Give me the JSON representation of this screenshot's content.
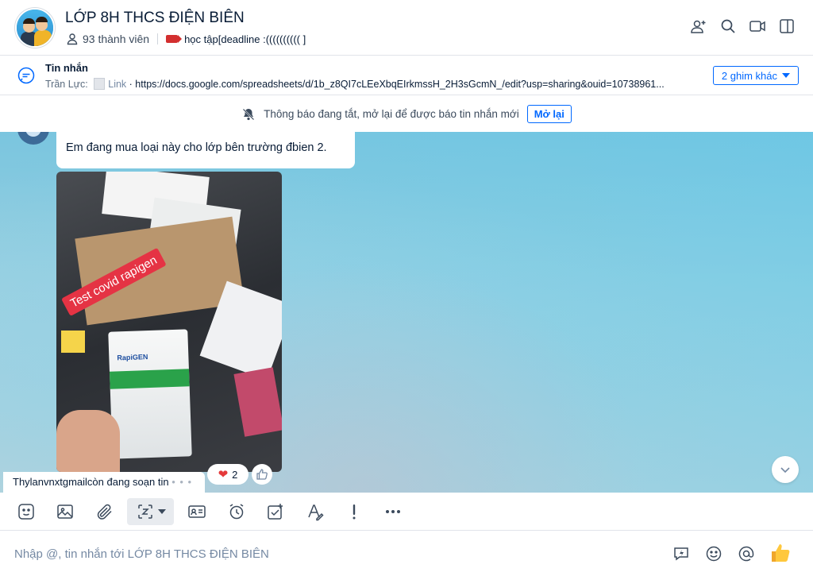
{
  "header": {
    "group_name": "LỚP 8H THCS ĐIỆN BIÊN",
    "members": "93 thành viên",
    "tag_label": "học tập[deadline :(((((((((( ]",
    "icons": [
      "add-member-icon",
      "search-icon",
      "video-call-icon",
      "sidebar-toggle-icon"
    ]
  },
  "pinned": {
    "title": "Tin nhắn",
    "sender": "Trần Lực:",
    "link_label": "Link",
    "link_text": "· https://docs.google.com/spreadsheets/d/1b_z8QI7cLEeXbqEIrkmssH_2H3sGcmN_/edit?usp=sharing&ouid=10738961...",
    "more_label": "2 ghim khác"
  },
  "notification": {
    "text": "Thông báo đang tắt, mở lại để được báo tin nhắn mới",
    "button": "Mở lại"
  },
  "chat": {
    "message_text": "Em đang mua loại này cho lớp bên trường đbien 2.",
    "image_sticker_text": "Test covid rapigen",
    "image_brand_text": "RapiGEN",
    "reaction_count": "2",
    "typing_text": "Thylanvnxtgmailcòn đang soạn tin",
    "typing_dots": "• • •"
  },
  "toolbar": {
    "items": [
      "sticker-icon",
      "image-icon",
      "attachment-icon",
      "screenshot-icon",
      "contact-card-icon",
      "reminder-icon",
      "task-icon",
      "format-text-icon",
      "important-icon",
      "more-icon"
    ]
  },
  "composer": {
    "placeholder": "Nhập @, tin nhắn tới LỚP 8H THCS ĐIỆN BIÊN",
    "icons": [
      "quick-message-icon",
      "emoji-icon",
      "mention-icon",
      "thumbs-up-icon"
    ]
  },
  "colors": {
    "accent": "#0068ff",
    "heart": "#e5393a",
    "tag": "#d32f2f",
    "thumbs_up": "#f5a623"
  }
}
